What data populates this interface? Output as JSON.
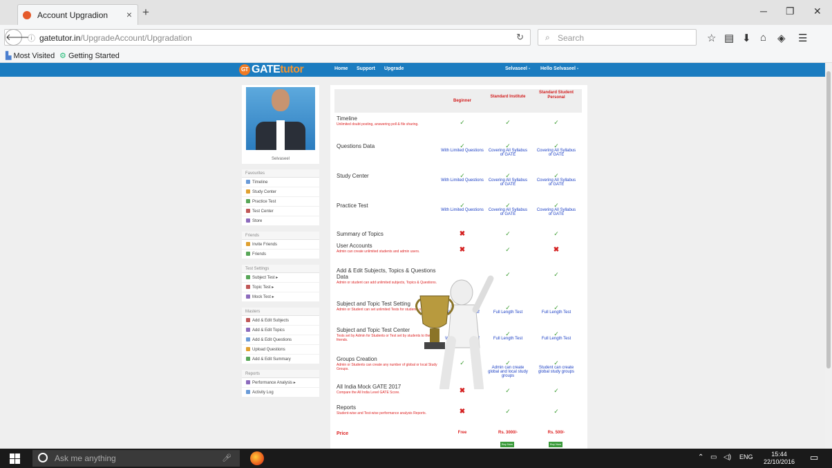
{
  "browser": {
    "tab_title": "Account Upgradion",
    "tab_close": "×",
    "new_tab": "+",
    "url_host": "gatetutor.in",
    "url_path": "/UpgradeAccount/Upgradation",
    "search_placeholder": "Search",
    "bookmarks": [
      "Most Visited",
      "Getting Started"
    ]
  },
  "site": {
    "logo_main": "GATE",
    "logo_accent": "tutor",
    "logo_badge": "GT",
    "nav": [
      "Home",
      "Support",
      "Upgrade"
    ],
    "user_menu": "Selvaseel -",
    "hello_menu": "Hello Selvaseel -"
  },
  "sidebar": {
    "profile_name": "Selvaseel",
    "groups": [
      {
        "title": "Favourites",
        "items": [
          "Timeline",
          "Study Center",
          "Practice Test",
          "Test Center",
          "Store"
        ]
      },
      {
        "title": "Friends",
        "items": [
          "Invite Friends",
          "Friends"
        ]
      },
      {
        "title": "Test Settings",
        "items": [
          "Subject Test ▸",
          "Topic Test ▸",
          "Mock Test ▸"
        ]
      },
      {
        "title": "Masters",
        "items": [
          "Add & Edit Subjects",
          "Add & Edit Topics",
          "Add & Edit Questions",
          "Upload Questions",
          "Add & Edit Summary"
        ]
      },
      {
        "title": "Reports",
        "items": [
          "Performance Analysis ▸",
          "Activity Log"
        ]
      }
    ]
  },
  "plans": {
    "headers": [
      "Beginner",
      "Standard Institute",
      "Standard Student Personal"
    ],
    "rows": [
      {
        "feature": "Timeline",
        "desc": "Unlimited doubt posting, answering poll & file sharing.",
        "cells": [
          [
            "check",
            ""
          ],
          [
            "check",
            ""
          ],
          [
            "check",
            ""
          ]
        ]
      },
      {
        "feature": "Questions Data",
        "desc": "",
        "cells": [
          [
            "check",
            "With Limited Questions"
          ],
          [
            "check",
            "Covering All Syllabus of GATE"
          ],
          [
            "check",
            "Covering All Syllabus of GATE"
          ]
        ]
      },
      {
        "feature": "Study Center",
        "desc": "",
        "cells": [
          [
            "check",
            "With Limited Questions"
          ],
          [
            "check",
            "Covering All Syllabus of GATE"
          ],
          [
            "check",
            "Covering All Syllabus of GATE"
          ]
        ]
      },
      {
        "feature": "Practice Test",
        "desc": "",
        "cells": [
          [
            "check",
            "With Limited Questions"
          ],
          [
            "check",
            "Covering All Syllabus of GATE"
          ],
          [
            "check",
            "Covering All Syllabus of GATE"
          ]
        ]
      },
      {
        "feature": "Summary of Topics",
        "desc": "",
        "cells": [
          [
            "cross",
            ""
          ],
          [
            "check",
            ""
          ],
          [
            "check",
            ""
          ]
        ]
      },
      {
        "feature": "User Accounts",
        "desc": "Admin can create unlimited students and admin users.",
        "cells": [
          [
            "cross",
            ""
          ],
          [
            "check",
            ""
          ],
          [
            "cross",
            ""
          ]
        ]
      },
      {
        "feature": "Add & Edit Subjects, Topics & Questions Data",
        "desc": "Admin or student can add unlimited subjects, Topics & Questions.",
        "cells": [
          [
            "",
            ""
          ],
          [
            "check",
            ""
          ],
          [
            "check",
            ""
          ]
        ]
      },
      {
        "feature": "Subject and Topic Test Setting",
        "desc": "Admin or Student can set unlimited Tests for students or friends.",
        "cells": [
          [
            "check",
            "With Limited no. of Questions"
          ],
          [
            "check",
            "Full Length Test"
          ],
          [
            "check",
            "Full Length Test"
          ]
        ]
      },
      {
        "feature": "Subject and Topic Test Center",
        "desc": "Tests set by Admin for Students or Test set by students to their friends.",
        "cells": [
          [
            "check",
            "With Limited no. of Questions"
          ],
          [
            "check",
            "Full Length Test"
          ],
          [
            "check",
            "Full Length Test"
          ]
        ]
      },
      {
        "feature": "Groups Creation",
        "desc": "Admin or Students can create any number of global or local Study Groups.",
        "cells": [
          [
            "check",
            ""
          ],
          [
            "check",
            "Admin can create global and local study groups"
          ],
          [
            "check",
            "Student can create global study groups"
          ]
        ]
      },
      {
        "feature": "All India Mock GATE 2017",
        "desc": "Compare the All India Level GATE Score.",
        "cells": [
          [
            "cross",
            ""
          ],
          [
            "check",
            ""
          ],
          [
            "check",
            ""
          ]
        ]
      },
      {
        "feature": "Reports",
        "desc": "Student-wise and Test-wise performance analysis Reports.",
        "cells": [
          [
            "cross",
            ""
          ],
          [
            "check",
            ""
          ],
          [
            "check",
            ""
          ]
        ]
      }
    ],
    "price_label": "Price",
    "prices": [
      "Free",
      "Rs. 3000/-",
      "Rs. 500/-"
    ],
    "buy_label": "Buy Now"
  },
  "taskbar": {
    "search_placeholder": "Ask me anything",
    "lang": "ENG",
    "time": "15:44",
    "date": "22/10/2016"
  }
}
